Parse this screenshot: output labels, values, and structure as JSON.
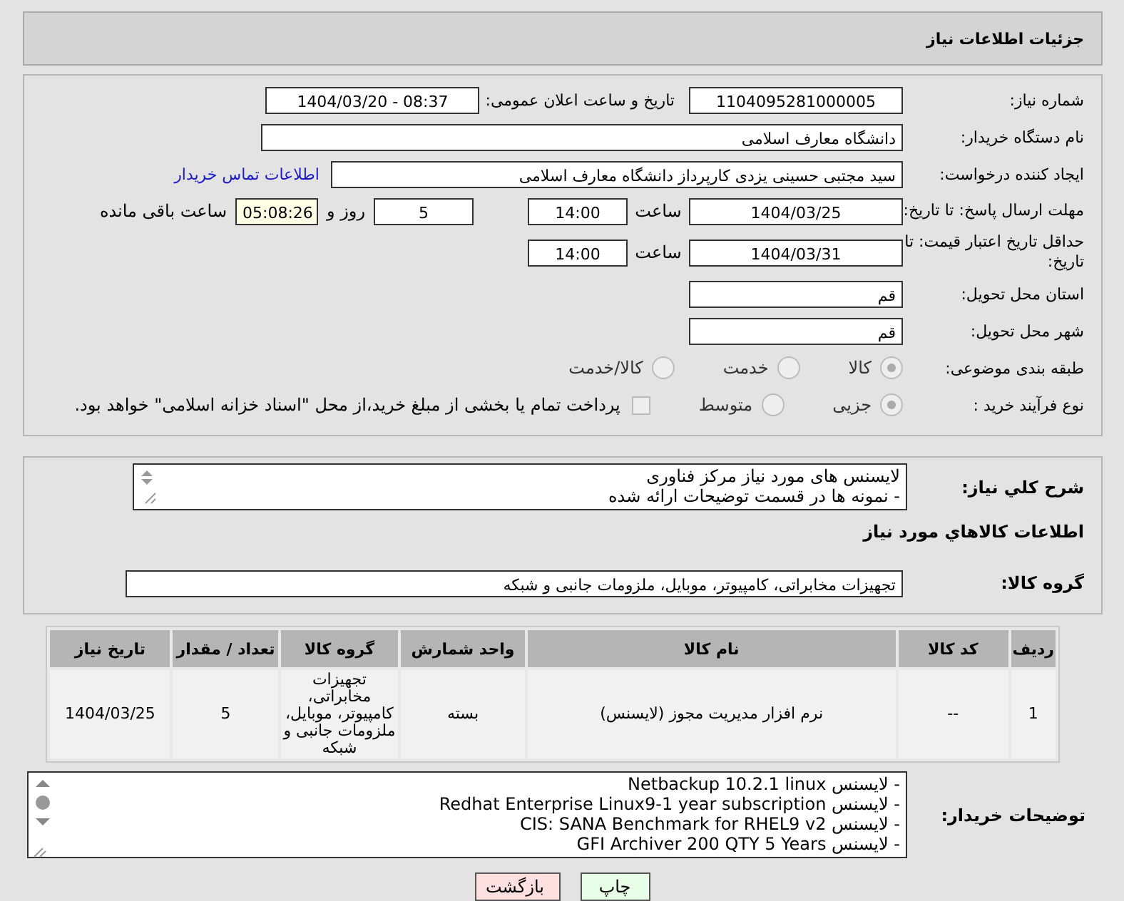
{
  "header": {
    "title": "جزئیات اطلاعات نیاز"
  },
  "form": {
    "need_number": {
      "label": "شماره نیاز:",
      "value": "1104095281000005"
    },
    "announce": {
      "label": "تاریخ و ساعت اعلان عمومی:",
      "value": "1404/03/20 - 08:37"
    },
    "buyer_org": {
      "label": "نام دستگاه خریدار:",
      "value": "دانشگاه معارف اسلامی"
    },
    "creator": {
      "label": "ایجاد کننده درخواست:",
      "value": "سید مجتبی حسینی یزدی کارپرداز دانشگاه معارف اسلامی",
      "link": "اطلاعات تماس خریدار"
    },
    "reply_deadline": {
      "label": "مهلت ارسال پاسخ: تا تاریخ:",
      "date": "1404/03/25",
      "time_label": "ساعت",
      "time": "14:00",
      "days": "5",
      "days_label": "روز و",
      "remaining": "05:08:26",
      "remaining_label": "ساعت باقی مانده"
    },
    "price_validity": {
      "label": "حداقل تاریخ اعتبار قیمت: تا تاریخ:",
      "date": "1404/03/31",
      "time_label": "ساعت",
      "time": "14:00"
    },
    "province": {
      "label": "استان محل تحویل:",
      "value": "قم"
    },
    "city": {
      "label": "شهر محل تحویل:",
      "value": "قم"
    },
    "category": {
      "label": "طبقه بندی موضوعی:",
      "options": [
        {
          "label": "کالا",
          "selected": true
        },
        {
          "label": "خدمت",
          "selected": false
        },
        {
          "label": "کالا/خدمت",
          "selected": false
        }
      ]
    },
    "process": {
      "label": "نوع فرآیند خرید :",
      "options": [
        {
          "label": "جزیی",
          "selected": true
        },
        {
          "label": "متوسط",
          "selected": false
        }
      ],
      "payment": {
        "checked": false,
        "label": "پرداخت تمام یا بخشی از مبلغ خرید،از محل \"اسناد خزانه اسلامی\" خواهد بود."
      }
    }
  },
  "description": {
    "label": "شرح کلي نیاز:",
    "lines": [
      "لایسنس های مورد نیاز مرکز فناوری",
      "- نمونه ها در قسمت توضیحات ارائه شده"
    ]
  },
  "goods_title": "اطلاعات کالاهاي مورد نیاز",
  "goods_group": {
    "label": "گروه کالا:",
    "value": "تجهیزات مخابراتی، کامپیوتر، موبایل، ملزومات جانبی و شبکه"
  },
  "table": {
    "columns": [
      "ردیف",
      "کد کالا",
      "نام کالا",
      "واحد شمارش",
      "گروه کالا",
      "تعداد / مقدار",
      "تاریخ نیاز"
    ],
    "rows": [
      [
        "1",
        "--",
        "نرم افزار مدیریت مجوز (لایسنس)",
        "بسته",
        "تجهیزات مخابراتی، کامپیوتر، موبایل، ملزومات جانبی و شبکه",
        "5",
        "1404/03/25"
      ]
    ]
  },
  "buyer_notes": {
    "label": "توضیحات خریدار:",
    "lines": [
      "- لایسنس Netbackup 10.2.1 linux",
      "- لایسنس  Redhat Enterprise Linux9-1 year subscription",
      "- لایسنس  CIS: SANA Benchmark for RHEL9 v2",
      "- لایسنس  GFI Archiver 200 QTY 5 Years"
    ]
  },
  "buttons": [
    {
      "label": "چاپ",
      "kind": "print"
    },
    {
      "label": "بازگشت",
      "kind": "back"
    }
  ]
}
